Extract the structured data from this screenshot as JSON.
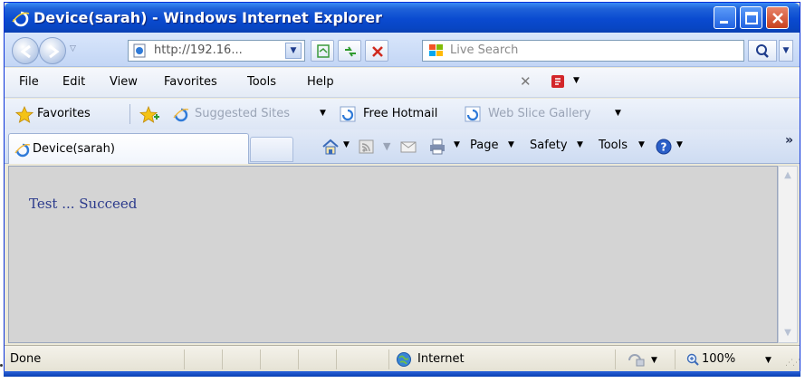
{
  "window": {
    "title": "Device(sarah) - Windows Internet Explorer"
  },
  "address_bar": {
    "url": "http://192.16...",
    "search_placeholder": "Live Search"
  },
  "menu": {
    "items": [
      "File",
      "Edit",
      "View",
      "Favorites",
      "Tools",
      "Help"
    ]
  },
  "favorites_bar": {
    "label": "Favorites",
    "links": [
      {
        "label": "Suggested Sites",
        "has_dropdown": true,
        "dimmed": true
      },
      {
        "label": "Free Hotmail",
        "has_dropdown": false,
        "dimmed": false
      },
      {
        "label": "Web Slice Gallery",
        "has_dropdown": true,
        "dimmed": true
      }
    ]
  },
  "tabs": {
    "active_tab": "Device(sarah)"
  },
  "command_bar": {
    "page_label": "Page",
    "safety_label": "Safety",
    "tools_label": "Tools",
    "more": "»"
  },
  "content": {
    "text": "Test ... Succeed"
  },
  "status_bar": {
    "status": "Done",
    "zone": "Internet",
    "zoom": "100%"
  },
  "colors": {
    "title_bar": "#0a4ad0",
    "content_bg": "#d4d4d4",
    "content_text": "#2b3a8c"
  }
}
